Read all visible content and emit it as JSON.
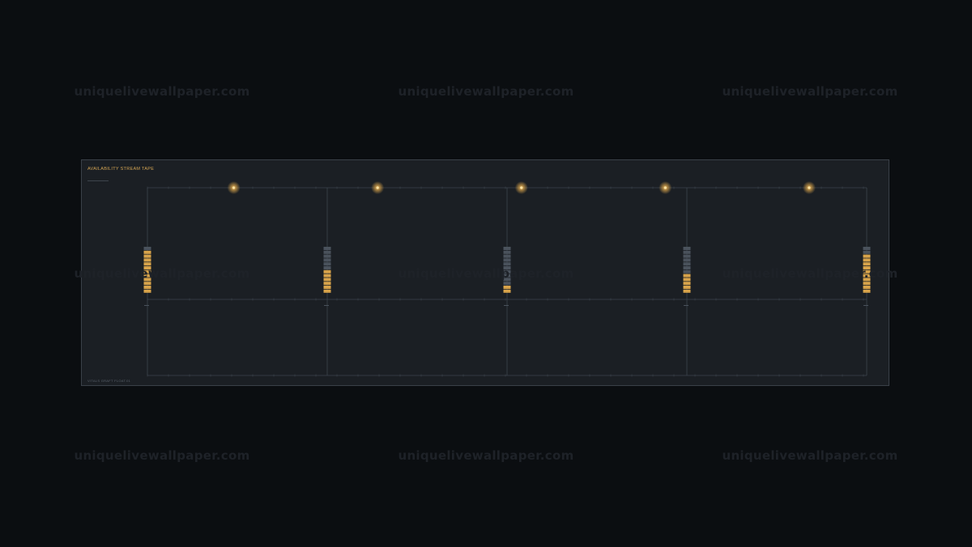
{
  "watermarks": [
    "uniquelivewallpaper.com",
    "uniquelivewallpaper.com",
    "uniquelivewallpaper.com",
    "uniquelivewallpaper.com",
    "uniquelivewallpaper.com",
    "uniquelivewallpaper.com",
    "uniquelivewallpaper.com",
    "uniquelivewallpaper.com",
    "uniquelivewallpaper.com"
  ],
  "panel": {
    "title": "AVAILABILITY STREAM TAPE",
    "footer": "VITALS GRAFT FLOAT.01"
  },
  "streams": {
    "count": 5,
    "segments_per_column": 12,
    "filled_fraction": [
      0.92,
      0.5,
      0.17,
      0.42,
      0.83
    ],
    "marker_glow_count": 5
  },
  "colors": {
    "background": "#0b0e11",
    "panel": "#1b1f24",
    "border": "#3a4048",
    "accent": "#d6a24a",
    "empty": "#4a525c",
    "grid": "#3d444d"
  }
}
